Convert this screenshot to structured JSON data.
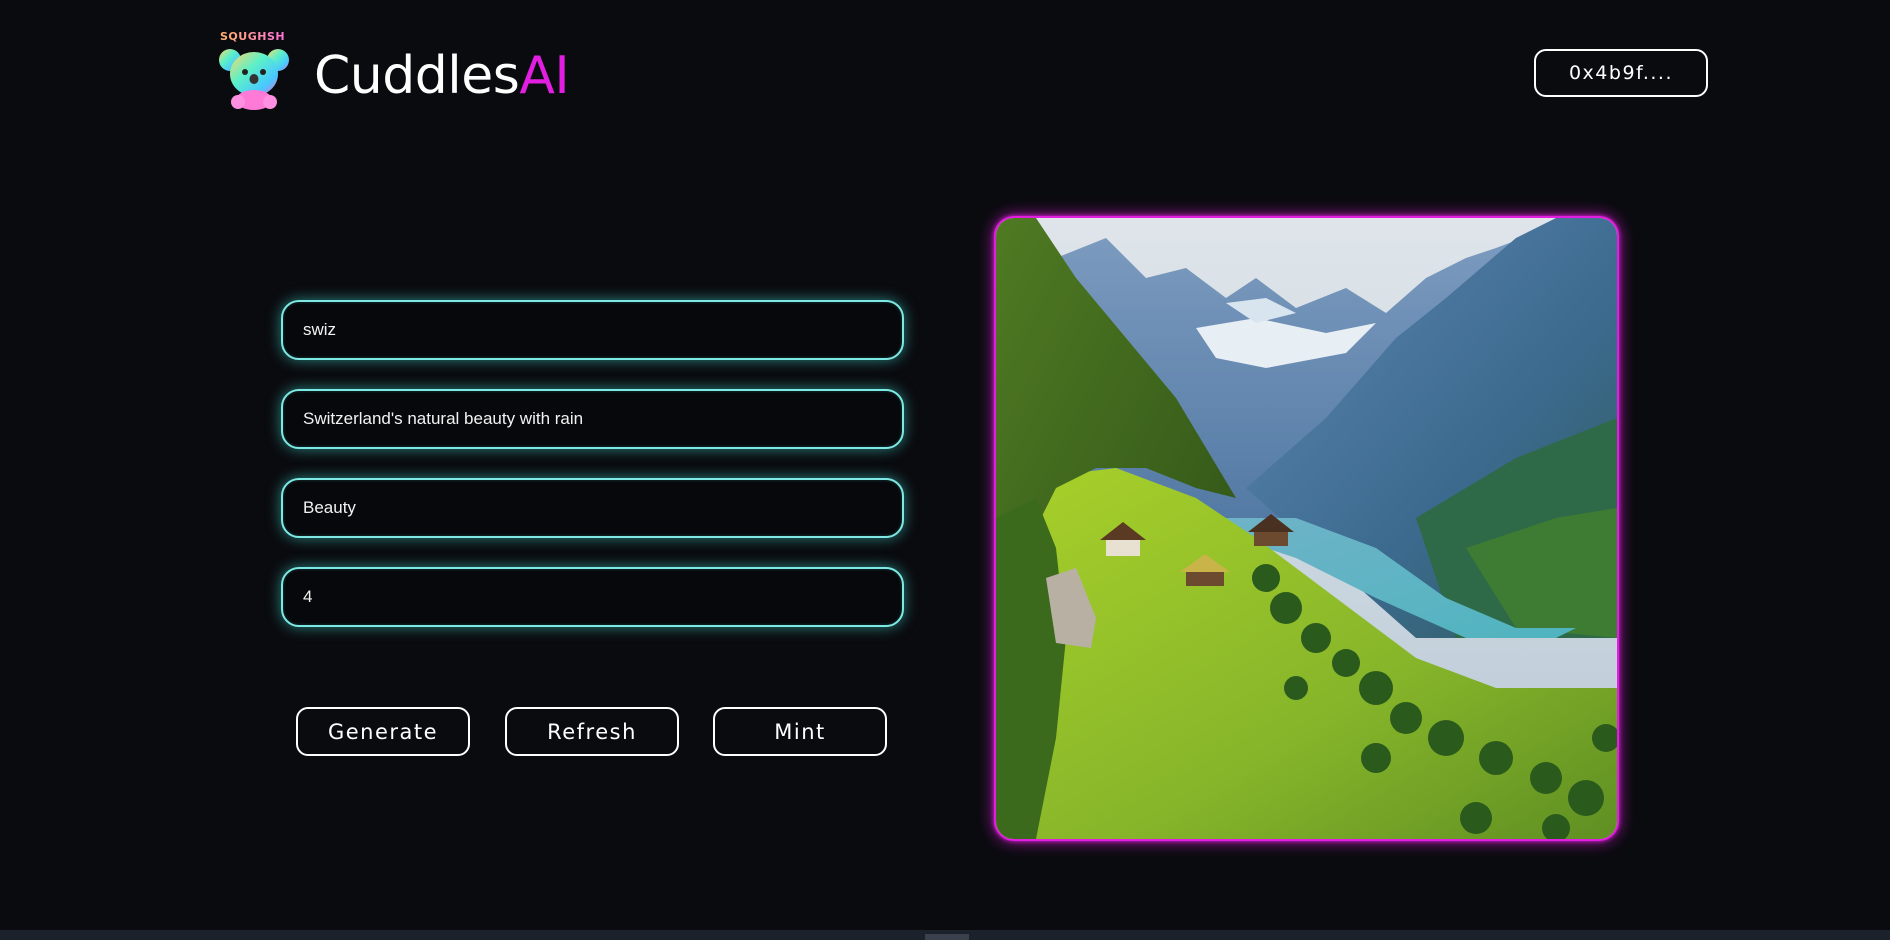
{
  "header": {
    "logo_text": "SQUGHSH",
    "brand_main": "Cuddles",
    "brand_accent": "AI",
    "wallet_label": "0x4b9f...."
  },
  "form": {
    "fields": [
      {
        "value": "swiz"
      },
      {
        "value": "Switzerland's natural beauty with rain"
      },
      {
        "value": "Beauty"
      },
      {
        "value": "4"
      }
    ]
  },
  "actions": {
    "generate_label": "Generate",
    "refresh_label": "Refresh",
    "mint_label": "Mint"
  },
  "colors": {
    "background": "#0a0b0f",
    "accent_magenta": "#e21ee0",
    "field_glow": "#7ee8e4"
  }
}
